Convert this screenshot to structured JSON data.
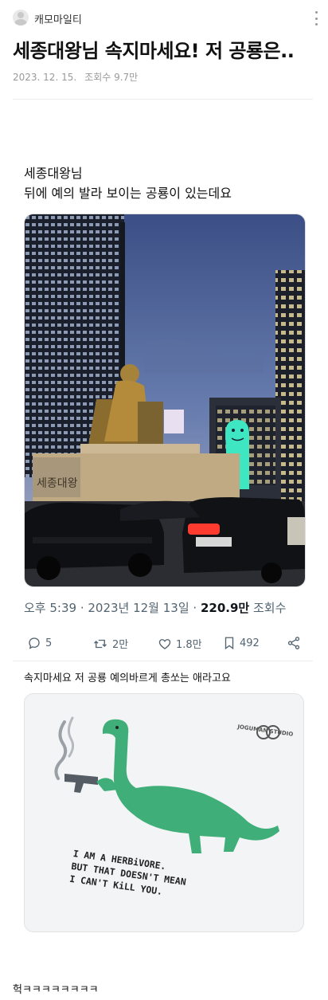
{
  "header": {
    "author": "캐모마일티",
    "menu_icon": "more-vertical-icon"
  },
  "post": {
    "title": "세종대왕님 속지마세요! 저 공룡은..",
    "date": "2023. 12. 15.",
    "views": "조회수 9.7만"
  },
  "tweet1": {
    "text_line1": "세종대왕님",
    "text_line2": "뒤에 예의 발라 보이는 공룡이 있는데요",
    "time": "오후 5:39 · 2023년 12월 13일 · ",
    "view_count": "220.9만",
    "view_label": " 조회수",
    "actions": {
      "replies": "5",
      "retweets": "2만",
      "likes": "1.8만",
      "bookmarks": "492"
    }
  },
  "tweet2": {
    "caption": "속지마세요 저 공룡 예의바르게 총쏘는 애라고요",
    "sticker_text": "I AM A HERBiVORE.\nBUT THAT DOESN'T MEAN\nI CAN'T KiLL YOU.",
    "brand": "JOGUMAN STUDIO"
  },
  "footer_text": "헉ㅋㅋㅋㅋㅋㅋㅋㅋ",
  "colors": {
    "accent_text": "#536471",
    "dino_green": "#3fae78"
  }
}
